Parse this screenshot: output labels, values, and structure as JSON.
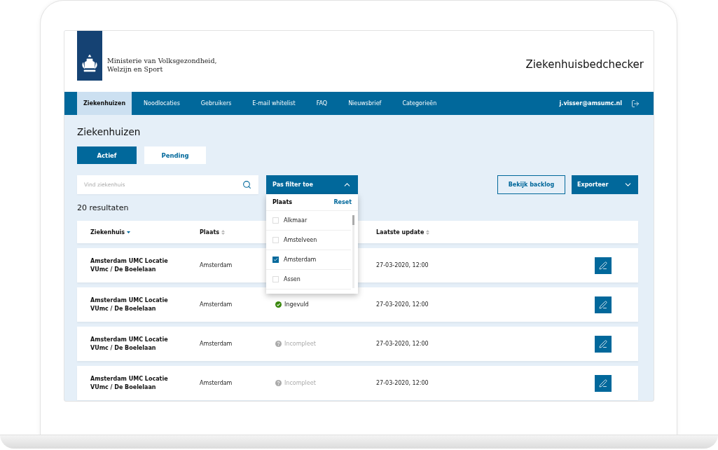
{
  "header": {
    "ministry": [
      "Ministerie van Volksgezondheid,",
      "Welzijn en Sport"
    ],
    "title": "Ziekenhuisbedchecker"
  },
  "nav": {
    "items": [
      {
        "label": "Ziekenhuizen",
        "selected": true
      },
      {
        "label": "Noodlocaties",
        "selected": false
      },
      {
        "label": "Gebruikers",
        "selected": false
      },
      {
        "label": "E-mail whitelist",
        "selected": false
      },
      {
        "label": "FAQ",
        "selected": false
      },
      {
        "label": "Nieuwsbrief",
        "selected": false
      },
      {
        "label": "Categorieën",
        "selected": false
      }
    ],
    "user": "j.visser@amsumc.nl"
  },
  "page_title": "Ziekenhuizen",
  "tabs": [
    {
      "label": "Actief",
      "selected": true
    },
    {
      "label": "Pending",
      "selected": false
    }
  ],
  "search": {
    "placeholder": "Vind ziekenhuis"
  },
  "filter": {
    "label": "Pas filter toe",
    "expanded": true,
    "title": "Plaats",
    "reset": "Reset",
    "options": [
      {
        "label": "Alkmaar",
        "checked": false
      },
      {
        "label": "Amstelveen",
        "checked": false
      },
      {
        "label": "Amsterdam",
        "checked": true
      },
      {
        "label": "Assen",
        "checked": false
      }
    ]
  },
  "backlog_button": "Bekijk backlog",
  "export_button": "Exporteer",
  "result_count": "20 resultaten",
  "table": {
    "columns": [
      {
        "label": "Ziekenhuis",
        "sorted": true
      },
      {
        "label": "Plaats",
        "sorted": false
      },
      {
        "label": "Laatste update",
        "sorted": false
      }
    ],
    "rows": [
      {
        "name": "Amsterdam UMC Locatie VUmc / De Boelelaan",
        "city": "Amsterdam",
        "updated": "27-03-2020, 12:00"
      },
      {
        "name": "Amsterdam UMC Locatie VUmc / De Boelelaan",
        "city": "Amsterdam",
        "status": {
          "kind": "complete",
          "label": "Ingevuld"
        },
        "updated": "27-03-2020, 12:00"
      },
      {
        "name": "Amsterdam UMC Locatie VUmc / De Boelelaan",
        "city": "Amsterdam",
        "status": {
          "kind": "incomplete",
          "label": "Incompleet"
        },
        "updated": "27-03-2020, 12:00"
      },
      {
        "name": "Amsterdam UMC Locatie VUmc / De Boelelaan",
        "city": "Amsterdam",
        "status": {
          "kind": "incomplete",
          "label": "Incompleet"
        },
        "updated": "27-03-2020, 12:00"
      }
    ]
  }
}
